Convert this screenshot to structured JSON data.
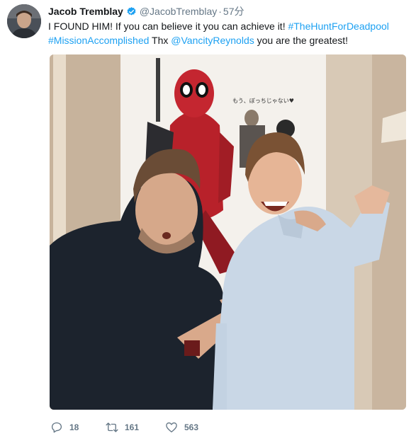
{
  "tweet": {
    "author_name": "Jacob Tremblay",
    "author_handle": "@JacobTremblay",
    "separator": "·",
    "time": "57分",
    "verified": true,
    "text": {
      "t1": "I FOUND HIM! If you can believe it you can achieve it! ",
      "tag1": "#TheHuntForDeadpool",
      "tag2": "#MissionAccomplished",
      "t2": " Thx ",
      "mention": "@VancityReynolds",
      "t3": " you are the greatest!"
    },
    "poster_text": "もう、ぼっちじゃない♥",
    "counts": {
      "replies": "18",
      "retweets": "161",
      "likes": "563"
    }
  },
  "colors": {
    "link": "#1da1f2",
    "muted": "#657786",
    "verified": "#1da1f2"
  },
  "icons": {
    "verified": "verified-badge-icon",
    "reply": "reply-icon",
    "retweet": "retweet-icon",
    "like": "heart-icon"
  }
}
